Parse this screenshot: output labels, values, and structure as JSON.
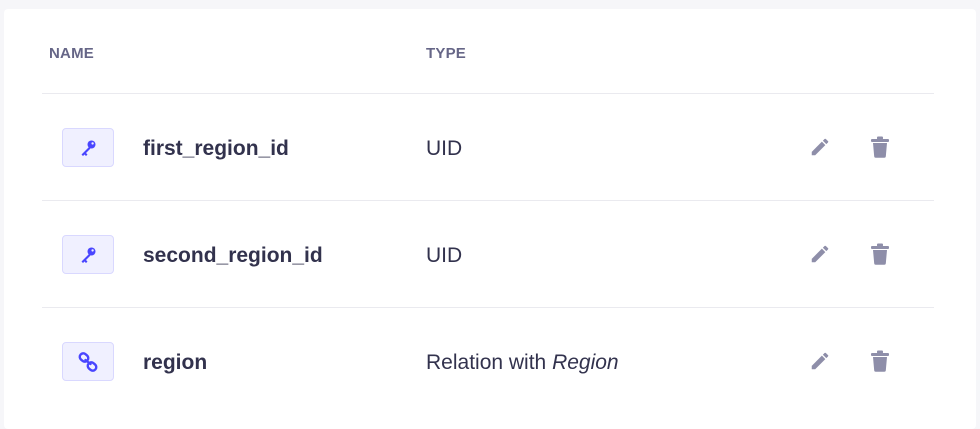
{
  "table": {
    "headers": {
      "name": "NAME",
      "type": "TYPE"
    },
    "rows": [
      {
        "icon": "key-icon",
        "name": "first_region_id",
        "type": "UID",
        "type_target": ""
      },
      {
        "icon": "key-icon",
        "name": "second_region_id",
        "type": "UID",
        "type_target": ""
      },
      {
        "icon": "relation-link-icon",
        "name": "region",
        "type": "Relation with ",
        "type_target": "Region"
      }
    ]
  },
  "colors": {
    "accent": "#4945ff",
    "icon_bg": "#f0f0ff",
    "text": "#32324d",
    "muted": "#8e8ea9"
  }
}
